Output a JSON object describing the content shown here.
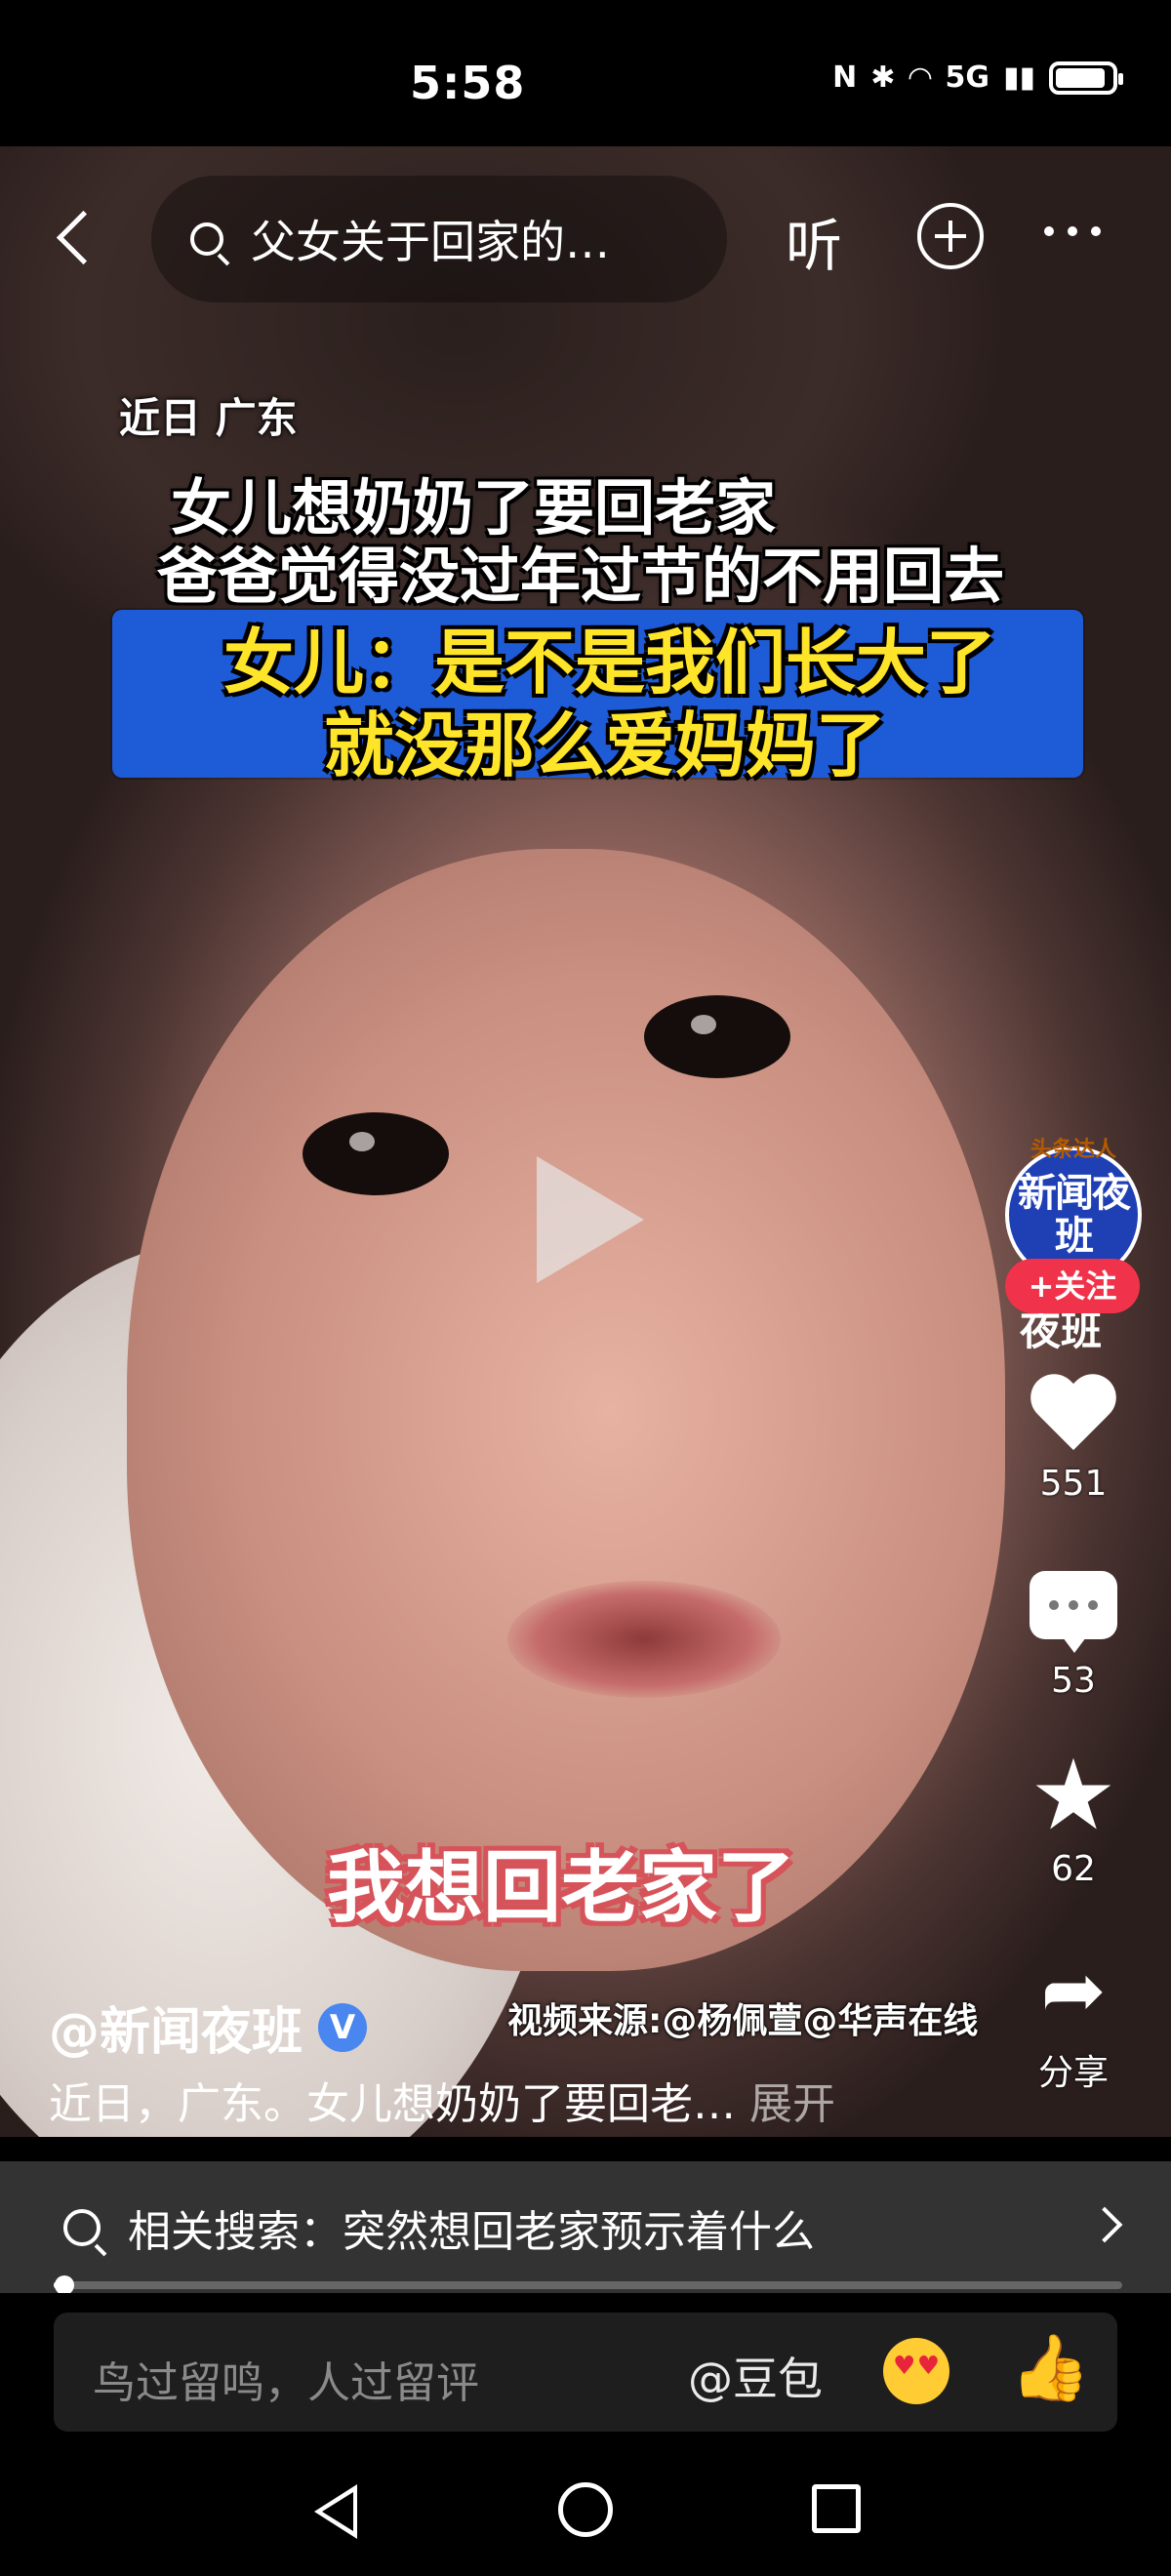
{
  "status_bar": {
    "time": "5:58",
    "signal_text": "5G"
  },
  "nav": {
    "search_query": "父女关于回家的…",
    "listen_label": "听"
  },
  "video": {
    "caption_small": "近日 广东",
    "caption_line1": "女儿想奶奶了要回老家",
    "caption_line2": "爸爸觉得没过年过节的不用回去",
    "highlight_line1": "女儿：是不是我们长大了",
    "highlight_line2": "就没那么爱妈妈了",
    "subtitle": "我想回老家了",
    "source": "视频来源:@杨佩萱@华声在线"
  },
  "rail": {
    "avatar_badge": "头条达人",
    "avatar_text": "新闻夜班",
    "follow_label": "+关注",
    "name_fragment": "夜班",
    "likes": "551",
    "comments": "53",
    "favorites": "62",
    "share_label": "分享"
  },
  "info": {
    "author": "@新闻夜班",
    "verified_mark": "V",
    "description": "近日，广东。女儿想奶奶了要回老…",
    "expand_label": "展开"
  },
  "related": {
    "text": "相关搜索：突然想回老家预示着什么"
  },
  "progress": {
    "fraction": 0.01
  },
  "comment_bar": {
    "placeholder": "鸟过留鸣，人过留评",
    "mention": "@豆包"
  },
  "colors": {
    "follow": "#f0334a",
    "highlight_box": "#1e5bd6",
    "highlight_text": "#ffe52a",
    "verified": "#4a86ef"
  },
  "icons": [
    "back-icon",
    "search-icon",
    "add-icon",
    "more-icon",
    "play-icon",
    "heart-icon",
    "comment-icon",
    "star-icon",
    "share-icon",
    "emoji-icon",
    "thumb-icon"
  ]
}
